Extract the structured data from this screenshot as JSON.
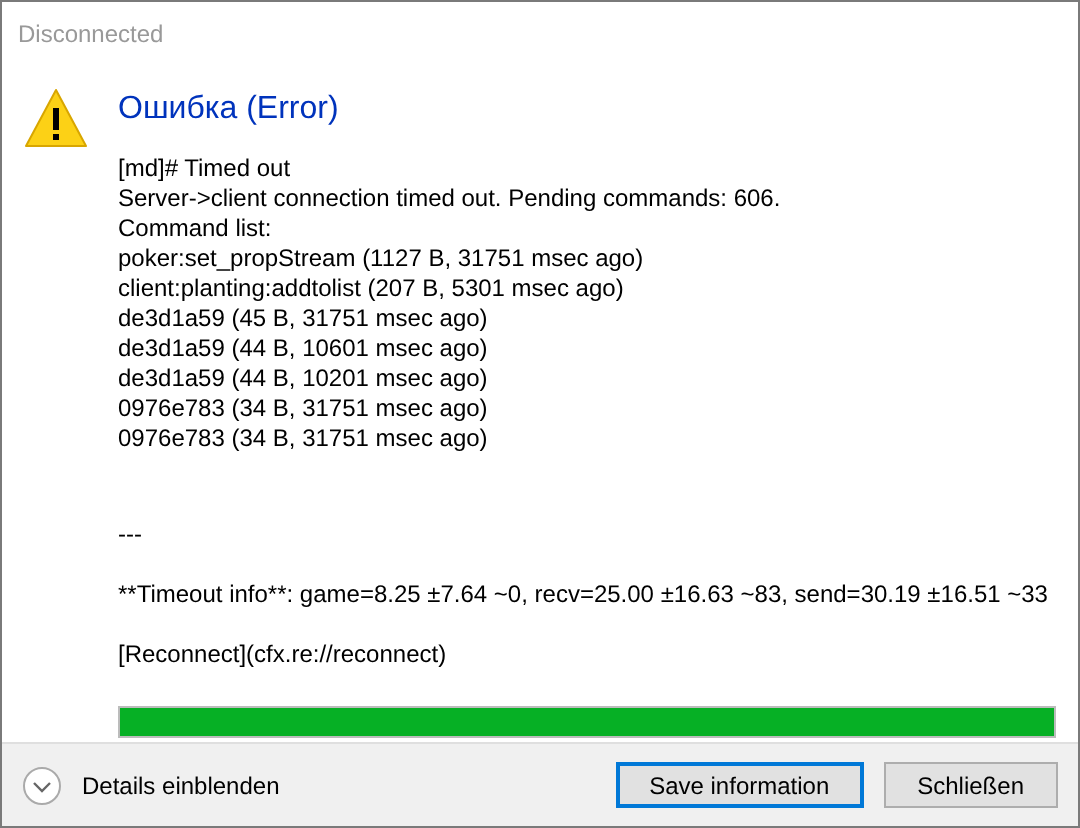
{
  "window": {
    "title": "Disconnected"
  },
  "heading": "Ошибка (Error)",
  "paragraphs": [
    [
      "[md]# Timed out",
      "Server->client connection timed out. Pending commands: 606.",
      "Command list:",
      "poker:set_propStream (1127 B, 31751 msec ago)",
      "client:planting:addtolist (207 B, 5301 msec ago)",
      "de3d1a59 (45 B, 31751 msec ago)",
      "de3d1a59 (44 B, 10601 msec ago)",
      "de3d1a59 (44 B, 10201 msec ago)",
      "0976e783 (34 B, 31751 msec ago)",
      "0976e783 (34 B, 31751 msec ago)"
    ],
    [
      "---"
    ],
    [
      "**Timeout info**: game=8.25 ±7.64 ~0, recv=25.00 ±16.63 ~83, send=30.19 ±16.51 ~33"
    ],
    [
      "[Reconnect](cfx.re://reconnect)"
    ]
  ],
  "progress": {
    "level": 1
  },
  "footer": {
    "details": "Details einblenden",
    "buttons": [
      {
        "label": "Save information",
        "selected": true
      },
      {
        "label": "Schließen",
        "selected": false
      }
    ]
  }
}
